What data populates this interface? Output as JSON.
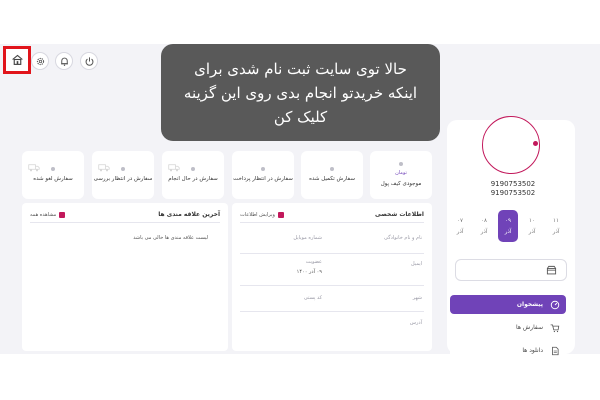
{
  "tooltip": {
    "line1": "حالا توی سایت ثبت نام شدی برای",
    "line2": "اینکه خریدتو انجام بدی روی این گزینه",
    "line3": "کلیک کن"
  },
  "toolbar": {
    "icons": [
      "home-icon",
      "settings-icon",
      "bell-icon",
      "power-icon"
    ]
  },
  "profile": {
    "phone_1": "9190753502",
    "phone_2": "9190753502",
    "days": [
      {
        "num": "۱۱",
        "month": "آذر"
      },
      {
        "num": "۱۰",
        "month": "آذر"
      },
      {
        "num": "۰۹",
        "month": "آذر"
      },
      {
        "num": "۰۸",
        "month": "آذر"
      },
      {
        "num": "۰۷",
        "month": "آذر"
      }
    ]
  },
  "menu": {
    "items": [
      {
        "label": "پیشخوان",
        "icon": "dashboard-icon"
      },
      {
        "label": "سفارش ها",
        "icon": "cart-icon"
      },
      {
        "label": "دانلود ها",
        "icon": "file-icon"
      }
    ]
  },
  "cards": [
    {
      "label": "موجودی کیف پول",
      "sub": "تومان"
    },
    {
      "label": "سفارش تکمیل شده",
      "sub": ""
    },
    {
      "label": "سفارش در انتظار پرداخت",
      "sub": ""
    },
    {
      "label": "سفارش در حال انجام",
      "sub": ""
    },
    {
      "label": "سفارش در انتظار بررسی",
      "sub": ""
    },
    {
      "label": "سفارش لغو شده",
      "sub": ""
    }
  ],
  "personal": {
    "title": "اطلاعات شخصی",
    "edit_label": "ویرایش اطلاعات",
    "fields": {
      "name": "نام و نام خانوادگی",
      "mobile": "شماره موبایل",
      "email": "ایمیل",
      "membership": "عضویت",
      "membership_value": "۰۹ آذر ۱۴۰۰",
      "city": "شهر",
      "postal": "کد پستی",
      "address": "آدرس"
    }
  },
  "favorites": {
    "title": "آخرین علاقه مندی ها",
    "view_label": "مشاهده همه",
    "empty": "لیست علاقه مندی ها خالی می باشد"
  },
  "colors": {
    "accent": "#7043b8",
    "highlight": "#e1141b",
    "tooltip_bg": "#595959",
    "ring": "#c2185b"
  }
}
